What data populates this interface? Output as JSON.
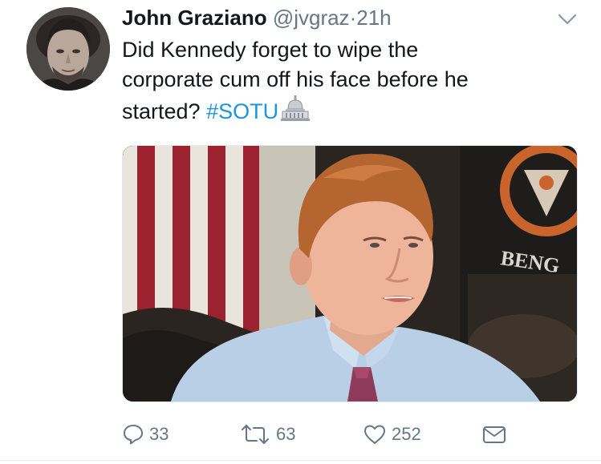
{
  "tweet": {
    "author_name": "John Graziano",
    "handle": "@jvgraz",
    "separator": "·",
    "timestamp": "21h",
    "text_lines": [
      "Did Kennedy forget to wipe the",
      "corporate cum off his face before he",
      "started?"
    ],
    "hashtag": "#SOTU",
    "emoji": "capitol-building-emoji"
  },
  "media": {
    "banner_text": "BENG"
  },
  "actions": {
    "replies": "33",
    "retweets": "63",
    "likes": "252"
  },
  "colors": {
    "link": "#1b95e0",
    "secondary_text": "#657786",
    "primary_text": "#14171a"
  }
}
